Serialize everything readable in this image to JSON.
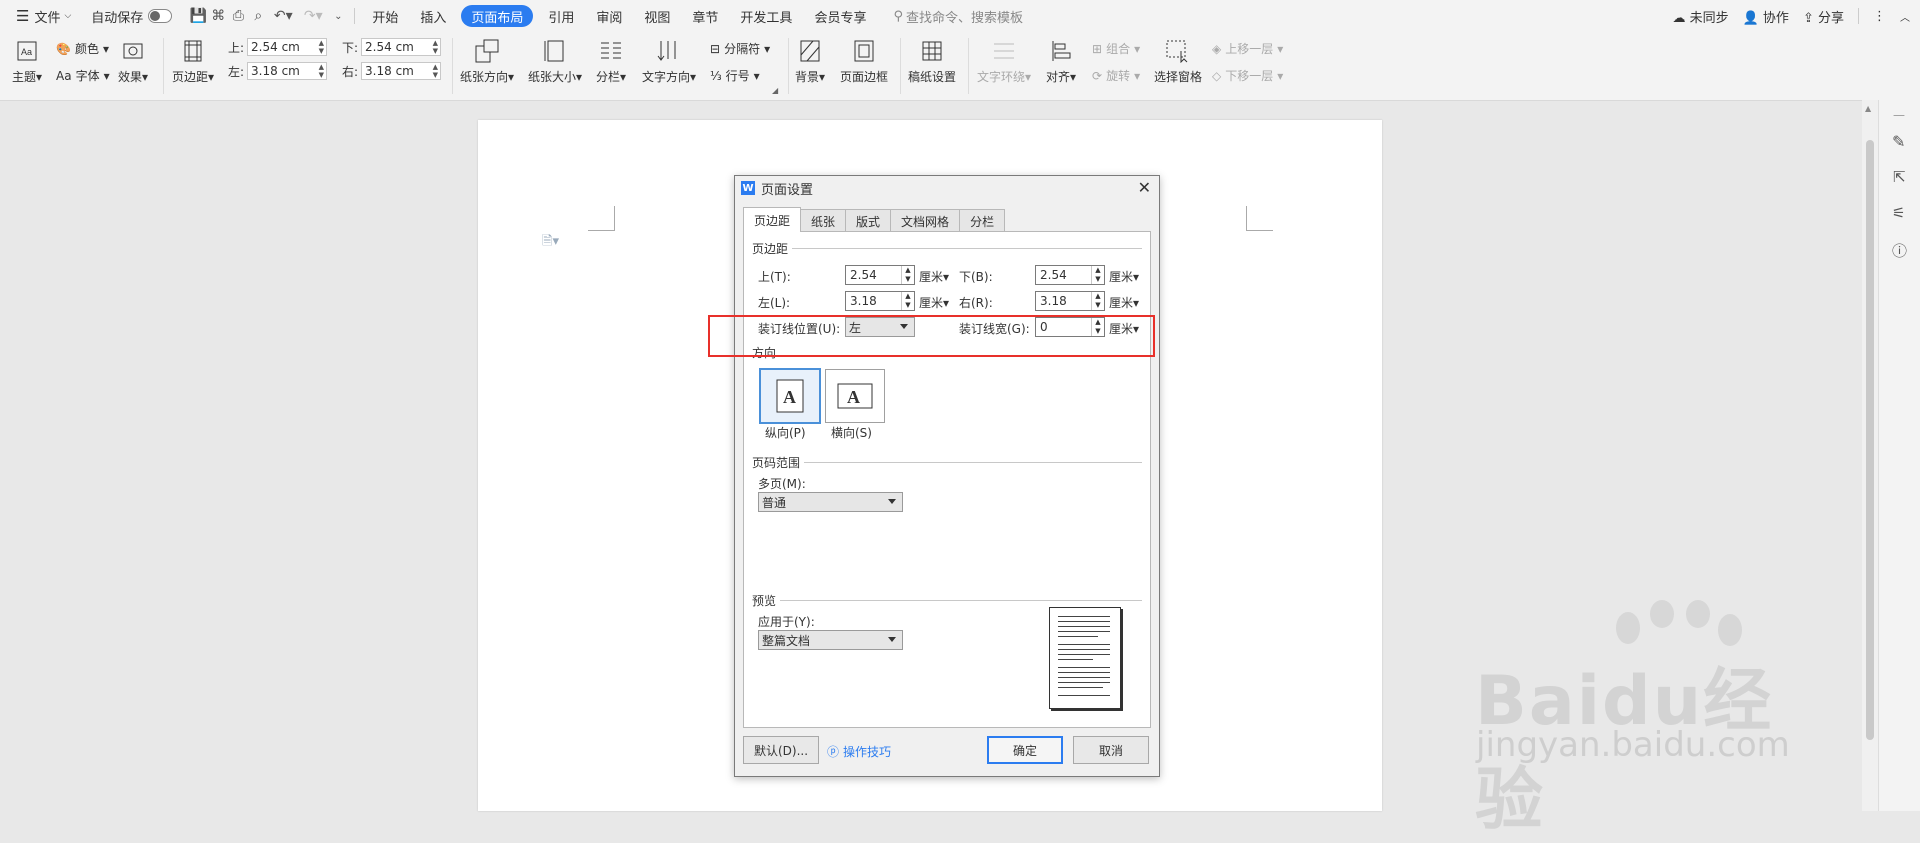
{
  "menubar": {
    "file": "文件",
    "autosave": "自动保存",
    "tabs": [
      "开始",
      "插入",
      "页面布局",
      "引用",
      "审阅",
      "视图",
      "章节",
      "开发工具",
      "会员专享"
    ],
    "active_tab": "页面布局",
    "search_placeholder": "查找命令、搜索模板",
    "sync": "未同步",
    "collab": "协作",
    "share": "分享"
  },
  "ribbon": {
    "theme": "主题",
    "color": "颜色",
    "font": "字体",
    "effect": "效果",
    "margins": "页边距",
    "top_label": "上:",
    "top_value": "2.54 cm",
    "bottom_label": "下:",
    "bottom_value": "2.54 cm",
    "left_label": "左:",
    "left_value": "3.18 cm",
    "right_label": "右:",
    "right_value": "3.18 cm",
    "orientation": "纸张方向",
    "size": "纸张大小",
    "columns": "分栏",
    "text_direction": "文字方向",
    "breaks": "分隔符",
    "line_numbers": "行号",
    "background": "背景",
    "page_border": "页面边框",
    "manuscript": "稿纸设置",
    "text_wrap": "文字环绕",
    "align": "对齐",
    "group": "组合",
    "rotate": "旋转",
    "selection_pane": "选择窗格",
    "bring_forward": "上移一层",
    "send_backward": "下移一层"
  },
  "dialog": {
    "title": "页面设置",
    "tabs": [
      "页边距",
      "纸张",
      "版式",
      "文档网格",
      "分栏"
    ],
    "margins_group": "页边距",
    "top": "上(T):",
    "top_value": "2.54",
    "bottom": "下(B):",
    "bottom_value": "2.54",
    "left": "左(L):",
    "left_value": "3.18",
    "right": "右(R):",
    "right_value": "3.18",
    "unit": "厘米",
    "gutter_pos": "装订线位置(U):",
    "gutter_pos_value": "左",
    "gutter_width": "装订线宽(G):",
    "gutter_width_value": "0",
    "orientation_group": "方向",
    "portrait": "纵向(P)",
    "landscape": "横向(S)",
    "page_range_group": "页码范围",
    "multiple_pages": "多页(M):",
    "multiple_pages_value": "普通",
    "preview_group": "预览",
    "apply_to": "应用于(Y):",
    "apply_to_value": "整篇文档",
    "default_btn": "默认(D)...",
    "tips": "操作技巧",
    "ok": "确定",
    "cancel": "取消"
  },
  "watermark": {
    "brand": "Baidu经验",
    "url": "jingyan.baidu.com"
  },
  "colors": {
    "accent": "#2b7cf0",
    "highlight": "#e8302a"
  }
}
